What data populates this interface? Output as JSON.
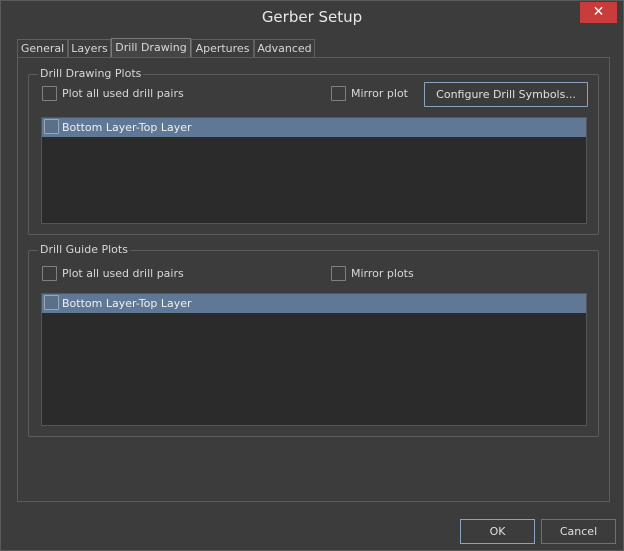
{
  "window": {
    "title": "Gerber Setup",
    "close_label": "✕"
  },
  "tabs": [
    {
      "label": "General"
    },
    {
      "label": "Layers"
    },
    {
      "label": "Drill Drawing"
    },
    {
      "label": "Apertures"
    },
    {
      "label": "Advanced"
    }
  ],
  "drill_drawing": {
    "group_title": "Drill Drawing Plots",
    "plot_all_label": "Plot all used drill pairs",
    "plot_all_checked": false,
    "mirror_label": "Mirror plot",
    "mirror_checked": false,
    "configure_button_label": "Configure Drill Symbols...",
    "rows": [
      {
        "label": "Bottom Layer-Top Layer",
        "checked": false,
        "selected": true
      }
    ]
  },
  "drill_guide": {
    "group_title": "Drill Guide Plots",
    "plot_all_label": "Plot all used drill pairs",
    "plot_all_checked": false,
    "mirror_label": "Mirror plots",
    "mirror_checked": false,
    "rows": [
      {
        "label": "Bottom Layer-Top Layer",
        "checked": false,
        "selected": true
      }
    ]
  },
  "footer": {
    "ok_label": "OK",
    "cancel_label": "Cancel"
  },
  "colors": {
    "accent": "#8ba3bf",
    "selection": "#5f7896",
    "close": "#c83c3c"
  }
}
